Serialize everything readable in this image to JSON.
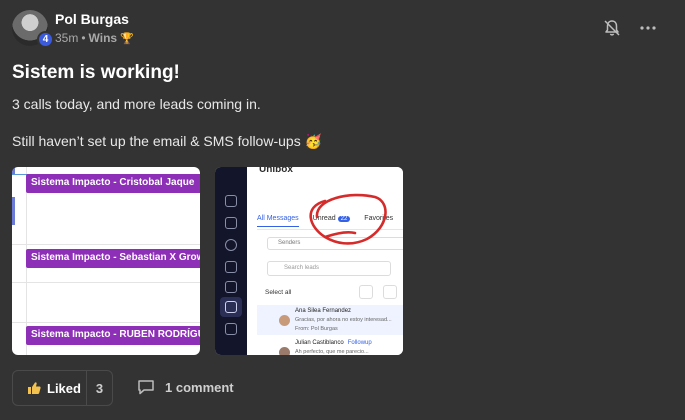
{
  "author": {
    "name": "Pol Burgas",
    "level": "4",
    "time": "35m",
    "separator": "•",
    "category": "Wins",
    "category_icon": "trophy-icon"
  },
  "actions": {
    "notify_icon": "bell-off-icon",
    "more_icon": "more-horizontal-icon"
  },
  "post": {
    "title": "Sistem is working!",
    "line1": "3 calls today, and more leads coming in.",
    "line2": "Still haven’t set up the email & SMS follow-ups 🥳"
  },
  "attachment1": {
    "tags": [
      "Sistema Impacto - Cristobal Jaque",
      "Sistema Impacto - Sebastian X Grow",
      "Sistema Impacto - RUBEN RODRÍGUEZ"
    ],
    "tag_color": "#8e2fb7"
  },
  "attachment2": {
    "title": "Unibox",
    "tabs": [
      "All Messages",
      "Unread",
      "Favorites"
    ],
    "unread_count": "22",
    "senders_label": "Senders",
    "search_placeholder": "Search leads",
    "select_all": "Select all",
    "rows": [
      {
        "name": "Ana Silea Fernandez",
        "snippet": "Gracias, por ahora no estoy interesad...",
        "from": "From: Pol Burgas"
      },
      {
        "name": "Julian Castiblanco",
        "badge": "Followup",
        "snippet": "Ah perfecto, que me parecio..."
      }
    ],
    "sidebar_badge": "22",
    "accent": "#3461e6",
    "scribble_color": "#d62b2b"
  },
  "footer": {
    "like_icon": "thumbs-up-icon",
    "like_label": "Liked",
    "like_count": "3",
    "comment_icon": "comment-icon",
    "comment_label": "1 comment"
  }
}
